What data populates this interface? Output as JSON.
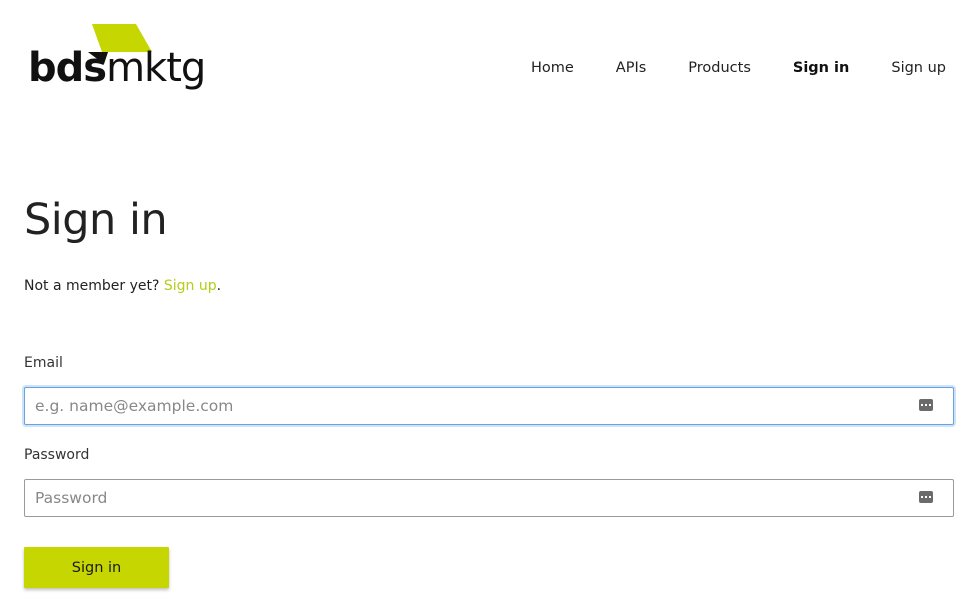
{
  "header": {
    "logo": {
      "bold": "bds",
      "light": "mktg",
      "brand_color": "#c6d600"
    },
    "nav": [
      {
        "label": "Home",
        "active": false
      },
      {
        "label": "APIs",
        "active": false
      },
      {
        "label": "Products",
        "active": false
      },
      {
        "label": "Sign in",
        "active": true
      },
      {
        "label": "Sign up",
        "active": false
      }
    ]
  },
  "main": {
    "title": "Sign in",
    "subtitle": {
      "prefix": "Not a member yet? ",
      "link": "Sign up",
      "suffix": "."
    },
    "email": {
      "label": "Email",
      "placeholder": "e.g. name@example.com",
      "value": "",
      "icon": "password-manager-icon"
    },
    "password": {
      "label": "Password",
      "placeholder": "Password",
      "value": "",
      "icon": "password-manager-icon"
    },
    "submit_label": "Sign in"
  },
  "colors": {
    "accent": "#c6d600",
    "link": "#b5cc18",
    "focus": "#66a3e0"
  }
}
